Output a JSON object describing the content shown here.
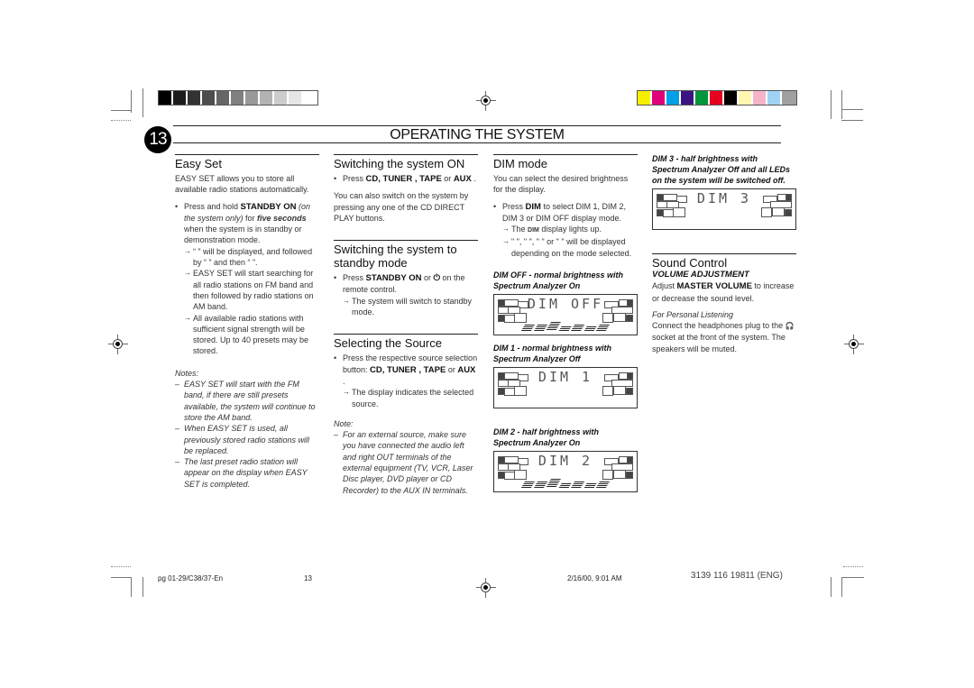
{
  "print_marks": {
    "grayscale_swatches": [
      "#000000",
      "#1c1c1c",
      "#333333",
      "#4d4d4d",
      "#666666",
      "#808080",
      "#999999",
      "#b3b3b3",
      "#cccccc",
      "#e6e6e6",
      "#ffffff"
    ],
    "color_swatches": [
      "#f7ef00",
      "#e0007a",
      "#00a0e6",
      "#3c1482",
      "#00963c",
      "#e6001e",
      "#000000",
      "#fff7b0",
      "#f5b4c8",
      "#a0d2f5",
      "#a0a0a0"
    ]
  },
  "header": {
    "page_number": "13",
    "title": "OPERATING THE SYSTEM"
  },
  "easy_set": {
    "heading": "Easy Set",
    "intro": "EASY SET allows you to store all available radio stations automatically.",
    "step_prefix": "Press and hold ",
    "step_key": "STANDBY ON",
    "step_italic": "(on the system only)",
    "step_mid": " for ",
    "step_bold": "five seconds",
    "step_suffix": " when the system is in standby or demonstration mode.",
    "result_1": "“              ” will be displayed, and followed by “            ” and then “        ”.",
    "result_2": "EASY SET will start searching for all radio stations on FM band and then followed by radio stations on AM band.",
    "result_3": "All available radio stations with sufficient signal strength will be stored. Up to 40 presets may be stored.",
    "notes_label": "Notes:",
    "notes": [
      "EASY SET will start with the FM band, if there are still presets available, the system will continue to store the AM band.",
      "When EASY SET is used, all previously stored radio stations will be replaced.",
      "The last preset radio station will appear on the display when EASY SET is completed."
    ]
  },
  "switch_on": {
    "heading": "Switching the system ON",
    "step_prefix": "Press ",
    "step_keys": "CD, TUNER , TAPE",
    "step_or": " or ",
    "step_key_last": "AUX",
    "step_end": " .",
    "para": "You can also switch on the system by pressing any one of the CD DIRECT PLAY buttons."
  },
  "standby": {
    "heading": "Switching the system to standby mode",
    "step_prefix": "Press ",
    "step_key": "STANDBY ON",
    "step_or": "  or ",
    "power_icon": "⏻",
    "step_suffix": " on the remote control.",
    "result": "The system will switch to standby mode."
  },
  "source": {
    "heading": "Selecting the Source",
    "step_prefix": "Press the respective source selection button: ",
    "step_keys": "CD, TUNER , TAPE",
    "step_or": " or ",
    "step_key_last": "AUX",
    "step_end": " .",
    "result": "The display indicates the selected source.",
    "note_label": "Note:",
    "note": "For an external source, make sure you have connected the audio left and right OUT terminals of the external equipment (TV, VCR, Laser Disc player, DVD player or CD Recorder) to the AUX IN terminals."
  },
  "dim": {
    "heading": "DIM mode",
    "intro": "You can select the desired brightness for the display.",
    "step_prefix": "Press ",
    "step_key": "DIM",
    "step_suffix": " to select DIM 1, DIM 2, DIM 3 or DIM OFF display mode.",
    "result_1_prefix": "The ",
    "result_1_key": "DIM",
    "result_1_suffix": " display lights up.",
    "result_2": "\"          \", \"          \", \"          \" or \"              \" will be displayed depending on the mode selected.",
    "modes": [
      {
        "caption": "DIM OFF - normal brightness with Spectrum Analyzer On",
        "display": "DIM OFF",
        "spectrum": true
      },
      {
        "caption": "DIM 1 - normal brightness with Spectrum Analyzer Off",
        "display": "DIM 1",
        "spectrum": false
      },
      {
        "caption": "DIM 2 - half brightness with Spectrum Analyzer On",
        "display": "DIM 2",
        "spectrum": true
      },
      {
        "caption": "DIM 3 - half brightness with Spectrum Analyzer Off and all LEDs on the system will be switched off.",
        "display": "DIM 3",
        "spectrum": false
      }
    ]
  },
  "sound": {
    "heading": "Sound Control",
    "subheading": "VOLUME ADJUSTMENT",
    "adjust_prefix": "Adjust ",
    "adjust_key": "MASTER VOLUME",
    "adjust_suffix": "  to increase or decrease the sound level.",
    "personal_label": "For Personal Listening",
    "personal_prefix": "Connect the headphones plug to the ",
    "headphone_icon": "🎧",
    "personal_suffix": " socket at the front of the system. The speakers will be muted."
  },
  "footer": {
    "file": "pg 01-29/C38/37-En",
    "page": "13",
    "timestamp": "2/16/00, 9:01 AM",
    "code": "3139 116 19811 (ENG)"
  }
}
